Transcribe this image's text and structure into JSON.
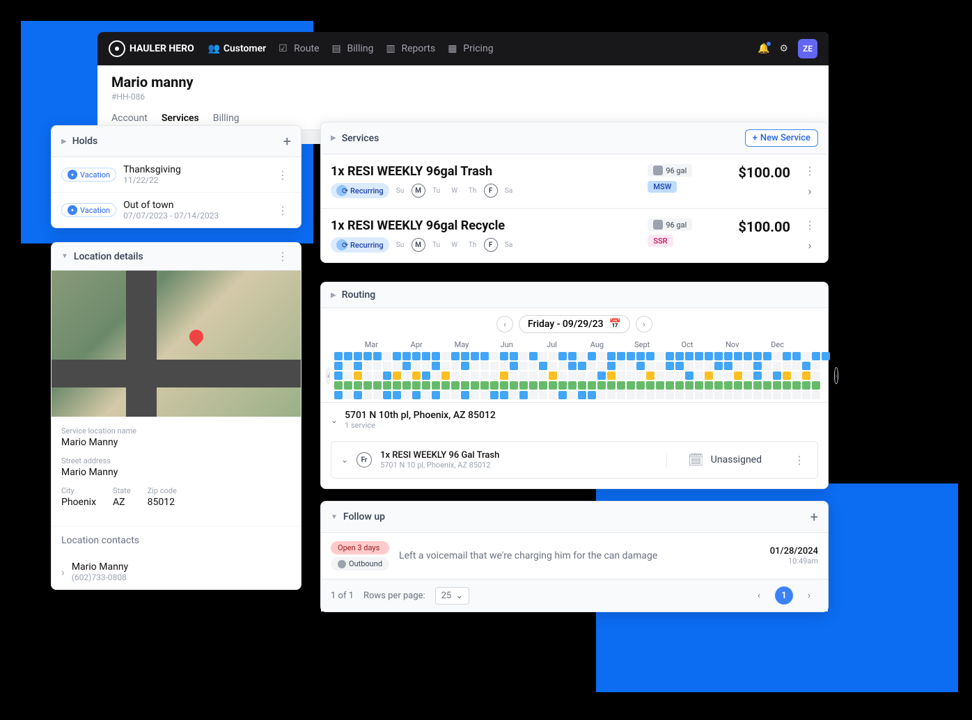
{
  "brand": "HAULER HERO",
  "nav": [
    "Customer",
    "Route",
    "Billing",
    "Reports",
    "Pricing"
  ],
  "user_initials": "ZE",
  "customer": {
    "name": "Mario manny",
    "id": "#HH-086"
  },
  "tabs": [
    "Account",
    "Services",
    "Billing"
  ],
  "holds": {
    "title": "Holds",
    "items": [
      {
        "badge": "Vacation",
        "title": "Thanksgiving",
        "date": "11/22/22"
      },
      {
        "badge": "Vacation",
        "title": "Out of town",
        "date": "07/07/2023 - 07/14/2023"
      }
    ]
  },
  "loc": {
    "title": "Location details",
    "name_lbl": "Service location name",
    "name": "Mario Manny",
    "street_lbl": "Street address",
    "street": "Mario Manny",
    "city_lbl": "City",
    "city": "Phoenix",
    "state_lbl": "State",
    "state": "AZ",
    "zip_lbl": "Zip code",
    "zip": "85012",
    "contacts_lbl": "Location contacts",
    "contact": {
      "name": "Mario Manny",
      "phone": "(602)733-0808"
    }
  },
  "services": {
    "title": "Services",
    "new_btn": "New Service",
    "recurring_lbl": "Recurring",
    "days": [
      "Su",
      "M",
      "Tu",
      "W",
      "Th",
      "F",
      "Sa"
    ],
    "items": [
      {
        "title": "1x RESI WEEKLY 96gal Trash",
        "circled_days": [
          "M",
          "F"
        ],
        "size": "96 gal",
        "cat": "MSW",
        "price": "$100.00"
      },
      {
        "title": "1x RESI WEEKLY 96gal Recycle",
        "circled_days": [
          "M",
          "F"
        ],
        "size": "96 gal",
        "cat": "SSR",
        "price": "$100.00"
      }
    ]
  },
  "routing": {
    "title": "Routing",
    "date": "Friday - 09/29/23",
    "months": [
      "Mar",
      "Apr",
      "May",
      "Jun",
      "Jul",
      "Aug",
      "Sept",
      "Oct",
      "Nov",
      "Dec"
    ],
    "addr": "5701 N 10th pl, Phoenix, AZ 85012",
    "addr_sub": "1 service",
    "stop": {
      "day": "Fr",
      "title": "1x RESI WEEKLY 96 Gal Trash",
      "addr": "5701 N 10 pl, Phoenix, AZ 85012",
      "status": "Unassigned"
    }
  },
  "followup": {
    "title": "Follow up",
    "open_lbl": "Open 3 days",
    "out_lbl": "Outbound",
    "msg": "Left a voicemail that we're charging him for the can damage",
    "date": "01/28/2024",
    "time": "10:49am",
    "count": "1 of 1",
    "rpp_lbl": "Rows per page:",
    "rpp_val": "25",
    "page": "1"
  }
}
